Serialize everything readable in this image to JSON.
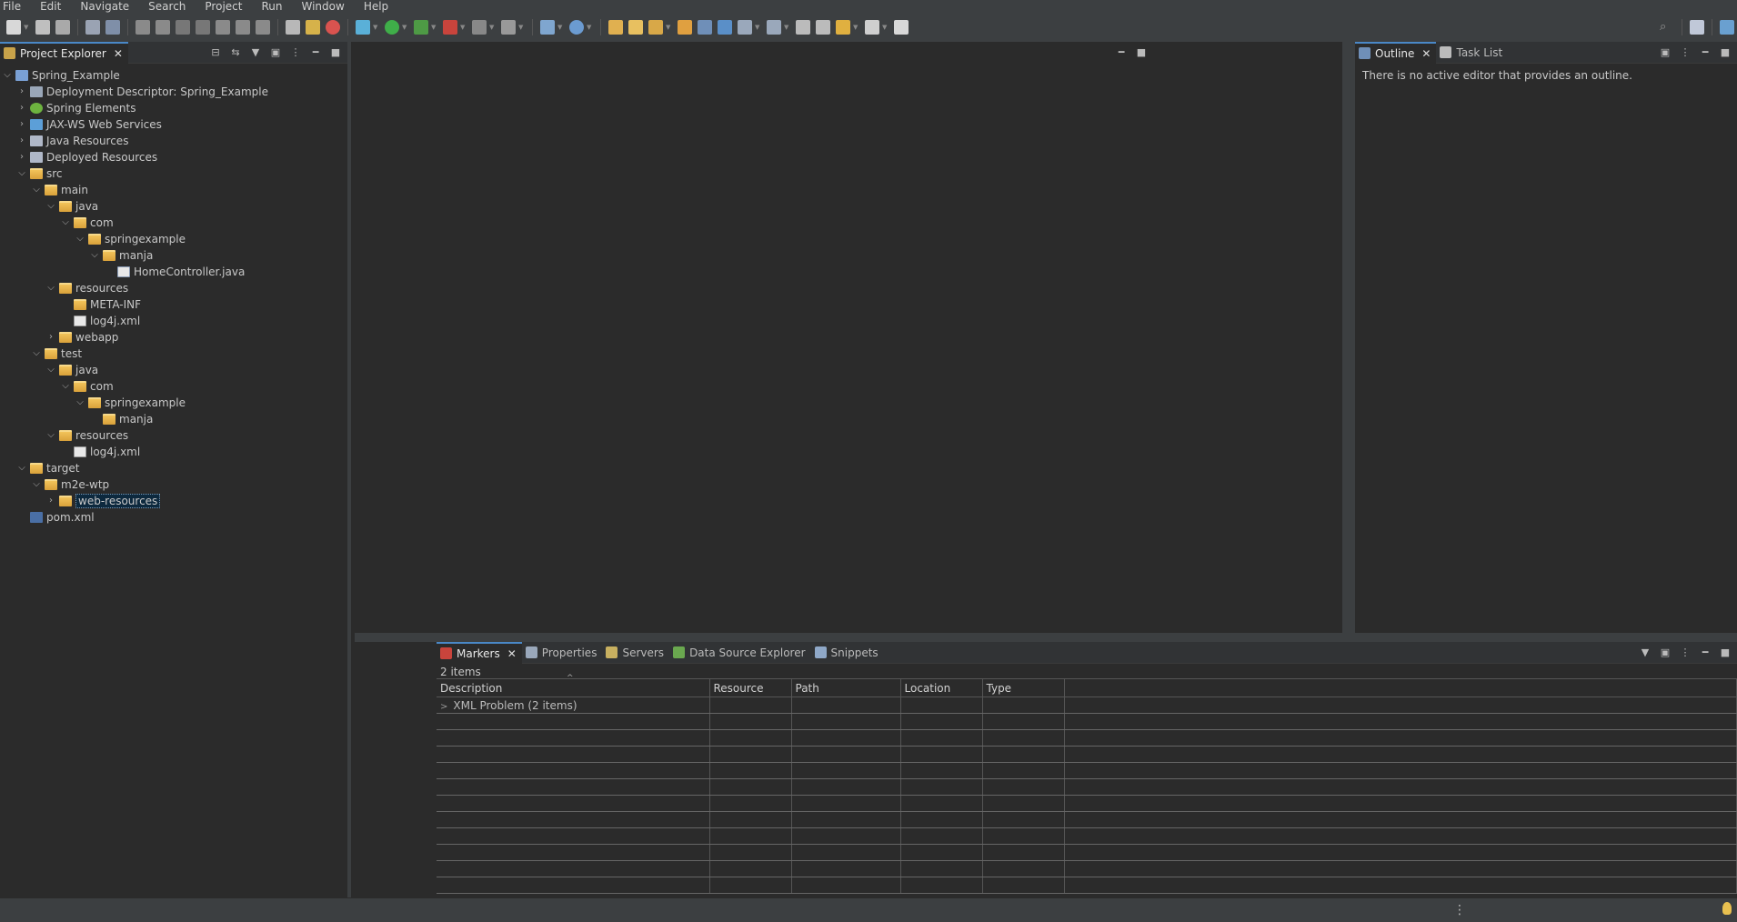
{
  "menubar": {
    "items": [
      "File",
      "Edit",
      "Navigate",
      "Search",
      "Project",
      "Run",
      "Window",
      "Help"
    ]
  },
  "colors": {
    "background": "#2b2b2b",
    "chrome": "#3c3f41",
    "active_tab_accent": "#4a88c7",
    "folder_icon": "#e8b44a",
    "selection": "#0d293e"
  },
  "project_explorer": {
    "tab_label": "Project Explorer",
    "tree": [
      {
        "label": "Spring_Example",
        "depth": 0,
        "expanded": true,
        "icon": "project-icon"
      },
      {
        "label": "Deployment Descriptor: Spring_Example",
        "depth": 1,
        "expanded": false,
        "icon": "deployment-descriptor-icon"
      },
      {
        "label": "Spring Elements",
        "depth": 1,
        "expanded": false,
        "icon": "spring-leaf-icon"
      },
      {
        "label": "JAX-WS Web Services",
        "depth": 1,
        "expanded": false,
        "icon": "web-services-icon"
      },
      {
        "label": "Java Resources",
        "depth": 1,
        "expanded": false,
        "icon": "java-resources-icon"
      },
      {
        "label": "Deployed Resources",
        "depth": 1,
        "expanded": false,
        "icon": "deployed-resources-icon"
      },
      {
        "label": "src",
        "depth": 1,
        "expanded": true,
        "icon": "folder-icon"
      },
      {
        "label": "main",
        "depth": 2,
        "expanded": true,
        "icon": "folder-icon"
      },
      {
        "label": "java",
        "depth": 3,
        "expanded": true,
        "icon": "folder-icon"
      },
      {
        "label": "com",
        "depth": 4,
        "expanded": true,
        "icon": "folder-icon"
      },
      {
        "label": "springexample",
        "depth": 5,
        "expanded": true,
        "icon": "folder-icon"
      },
      {
        "label": "manja",
        "depth": 6,
        "expanded": true,
        "icon": "folder-icon"
      },
      {
        "label": "HomeController.java",
        "depth": 7,
        "leaf": true,
        "icon": "java-file-icon"
      },
      {
        "label": "resources",
        "depth": 3,
        "expanded": true,
        "icon": "folder-icon"
      },
      {
        "label": "META-INF",
        "depth": 4,
        "leaf": true,
        "icon": "folder-icon"
      },
      {
        "label": "log4j.xml",
        "depth": 4,
        "leaf": true,
        "icon": "xml-file-icon"
      },
      {
        "label": "webapp",
        "depth": 3,
        "expanded": false,
        "icon": "folder-icon"
      },
      {
        "label": "test",
        "depth": 2,
        "expanded": true,
        "icon": "folder-icon"
      },
      {
        "label": "java",
        "depth": 3,
        "expanded": true,
        "icon": "folder-icon"
      },
      {
        "label": "com",
        "depth": 4,
        "expanded": true,
        "icon": "folder-icon"
      },
      {
        "label": "springexample",
        "depth": 5,
        "expanded": true,
        "icon": "folder-icon"
      },
      {
        "label": "manja",
        "depth": 6,
        "leaf": true,
        "icon": "folder-icon"
      },
      {
        "label": "resources",
        "depth": 3,
        "expanded": true,
        "icon": "folder-icon"
      },
      {
        "label": "log4j.xml",
        "depth": 4,
        "leaf": true,
        "icon": "xml-file-icon"
      },
      {
        "label": "target",
        "depth": 1,
        "expanded": true,
        "icon": "folder-icon"
      },
      {
        "label": "m2e-wtp",
        "depth": 2,
        "expanded": true,
        "icon": "folder-icon"
      },
      {
        "label": "web-resources",
        "depth": 3,
        "expanded": false,
        "icon": "folder-icon",
        "selected": true
      },
      {
        "label": "pom.xml",
        "depth": 1,
        "leaf": true,
        "icon": "pom-file-icon"
      }
    ]
  },
  "outline": {
    "tabs": [
      "Outline",
      "Task List"
    ],
    "message": "There is no active editor that provides an outline."
  },
  "markers": {
    "tabs": [
      "Markers",
      "Properties",
      "Servers",
      "Data Source Explorer",
      "Snippets"
    ],
    "count": "2 items",
    "columns": [
      "Description",
      "Resource",
      "Path",
      "Location",
      "Type"
    ],
    "rows": [
      {
        "description": "XML Problem (2 items)",
        "resource": "",
        "path": "",
        "location": "",
        "type": ""
      }
    ]
  }
}
